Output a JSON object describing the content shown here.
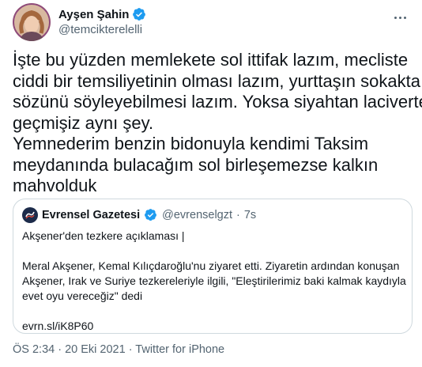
{
  "author": {
    "display_name": "Ayşen Şahin",
    "handle": "@temcikterelelli",
    "verified": true
  },
  "tweet": {
    "lines": [
      "İşte bu yüzden memlekete sol ittifak lazım, mecliste",
      "ciddi bir temsiliyetinin olması lazım, yurttaşın sokakta",
      "sözünü söyleyebilmesi lazım. Yoksa siyahtan laciverte",
      "geçmişiz aynı şey.",
      "Yemnederim benzin bidonuyla kendimi Taksim",
      "meydanında bulacağım sol birleşemezse kalkın",
      "mahvolduk"
    ]
  },
  "quoted_tweet": {
    "display_name": "Evrensel Gazetesi",
    "verified": true,
    "handle": "@evrenselgzt",
    "separator": "·",
    "time": "7s",
    "headline": "Akşener'den tezkere açıklaması |",
    "body_lines": [
      "Meral Akşener, Kemal Kılıçdaroğlu'nu ziyaret etti. Ziyaretin ardından konuşan",
      "Akşener, Irak ve Suriye tezkereleriyle ilgili, \"Eleştirilerimiz baki kalmak kaydıyla",
      "evet oyu vereceğiz\" dedi"
    ],
    "link": "evrn.sl/iK8P60"
  },
  "meta": {
    "text": "ÖS 2:34 · 20 Eki 2021 · Twitter for iPhone"
  },
  "colors": {
    "verified_blue": "#1d9bf0",
    "text": "#0f1419",
    "secondary": "#536471",
    "border": "#cfd9de"
  },
  "icons": {
    "verified": "verified-badge-icon",
    "more": "more-options-icon"
  }
}
